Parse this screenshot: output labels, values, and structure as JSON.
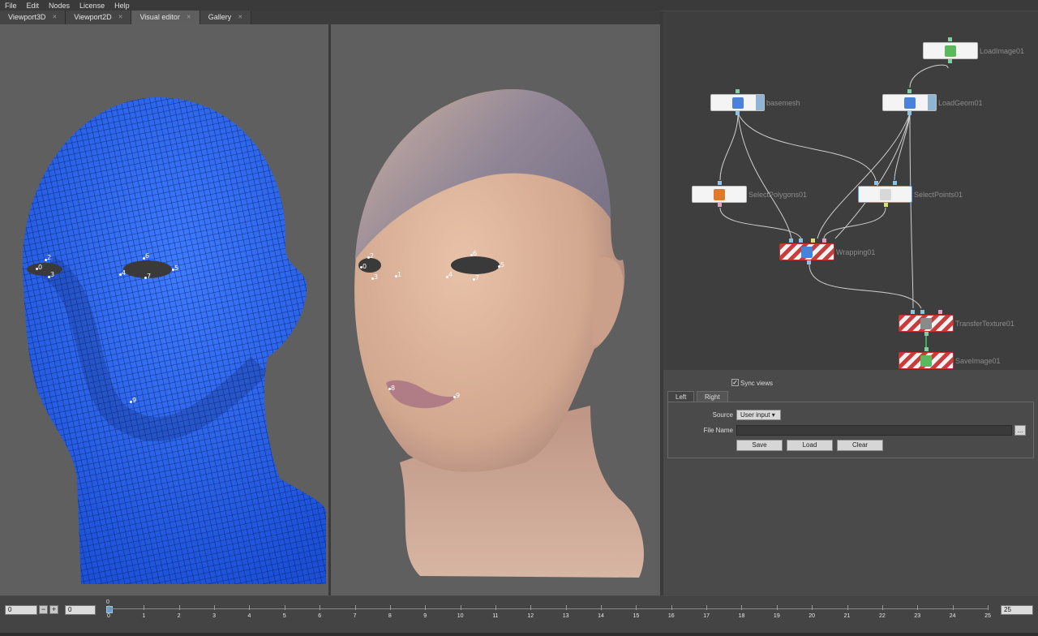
{
  "menu": [
    "File",
    "Edit",
    "Nodes",
    "License",
    "Help"
  ],
  "tabs": [
    {
      "label": "Viewport3D",
      "active": false
    },
    {
      "label": "Viewport2D",
      "active": false
    },
    {
      "label": "Visual editor",
      "active": true
    },
    {
      "label": "Gallery",
      "active": false
    }
  ],
  "left_landmarks": [
    "0",
    "1",
    "2",
    "3",
    "4",
    "5",
    "6",
    "7",
    "9"
  ],
  "right_landmarks": [
    "0",
    "1",
    "2",
    "3",
    "4",
    "5",
    "6",
    "7",
    "8",
    "9"
  ],
  "nodes": {
    "loadimage": "LoadImage01",
    "basemesh": "basemesh",
    "loadgeom": "LoadGeom01",
    "selectpolygons": "SelectPolygons01",
    "selectpoints": "SelectPoints01",
    "wrapping": "Wrapping01",
    "transfertexture": "TransferTexture01",
    "saveimage": "SaveImage01"
  },
  "props": {
    "sync_views_label": "Sync views",
    "sync_checked": "✓",
    "tab_left": "Left",
    "tab_right": "Right",
    "source_label": "Source",
    "source_value": "User input",
    "filename_label": "File Name",
    "browse_label": "...",
    "save_label": "Save",
    "load_label": "Load",
    "clear_label": "Clear"
  },
  "timeline": {
    "start_value": "0",
    "current_value": "0",
    "end_value": "25",
    "minus": "−",
    "plus": "+",
    "marker": "0",
    "ticks": [
      "0",
      "1",
      "2",
      "3",
      "4",
      "5",
      "6",
      "7",
      "8",
      "9",
      "10",
      "11",
      "12",
      "13",
      "14",
      "15",
      "16",
      "17",
      "18",
      "19",
      "20",
      "21",
      "22",
      "23",
      "24",
      "25"
    ]
  }
}
